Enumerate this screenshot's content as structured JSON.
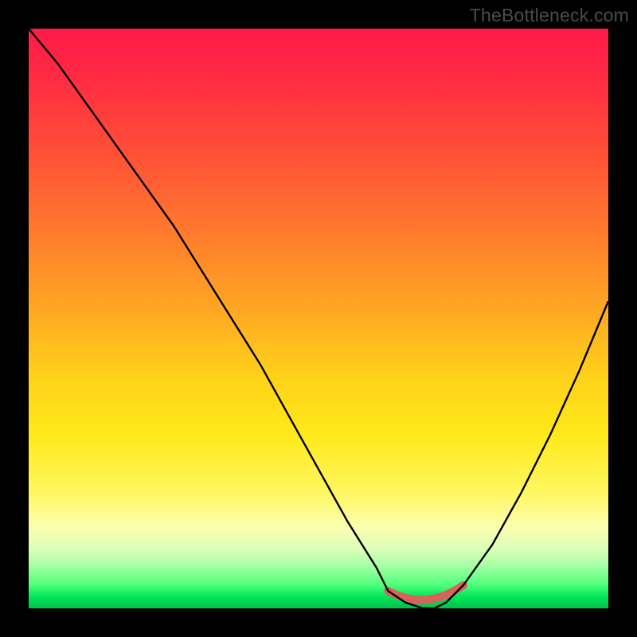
{
  "watermark": "TheBottleneck.com",
  "chart_data": {
    "type": "line",
    "title": "",
    "xlabel": "",
    "ylabel": "",
    "xlim": [
      0,
      100
    ],
    "ylim": [
      0,
      100
    ],
    "x": [
      0,
      5,
      10,
      15,
      20,
      25,
      30,
      35,
      40,
      45,
      50,
      55,
      60,
      62,
      65,
      68,
      70,
      72,
      75,
      80,
      85,
      90,
      95,
      100
    ],
    "values": [
      100,
      94,
      87,
      80,
      73,
      66,
      58,
      50,
      42,
      33,
      24,
      15,
      7,
      3,
      1,
      0,
      0,
      1,
      4,
      11,
      20,
      30,
      41,
      53
    ],
    "notes": "V-shaped bottleneck curve; minimum (optimal zone) around x≈65–72 where mismatch ≈0%. Background gradient encodes severity: red (top, high mismatch) through yellow to green (bottom, 0%).",
    "optimal_band_x": [
      62,
      75
    ],
    "gradient_stops": [
      {
        "pct": 0,
        "color": "#ff1b48"
      },
      {
        "pct": 50,
        "color": "#ffc21f"
      },
      {
        "pct": 80,
        "color": "#fff761"
      },
      {
        "pct": 100,
        "color": "#00c24a"
      }
    ]
  }
}
